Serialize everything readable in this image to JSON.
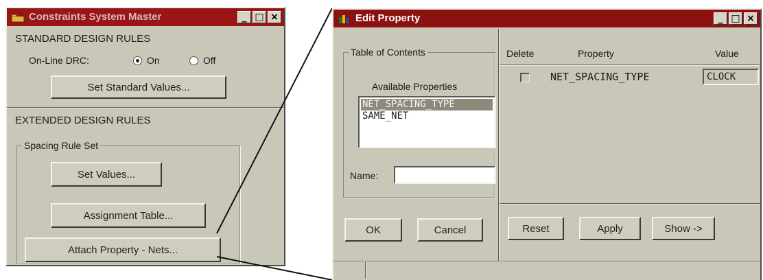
{
  "left_window": {
    "title": "Constraints System Master",
    "standard_section": "STANDARD DESIGN RULES",
    "online_drc_label": "On-Line DRC:",
    "radio_on_label": "On",
    "radio_off_label": "Off",
    "radio_selected": "On",
    "set_standard_values_button": "Set Standard Values...",
    "extended_section": "EXTENDED DESIGN RULES",
    "spacing_group_label": "Spacing Rule Set",
    "set_values_button": "Set Values...",
    "assignment_table_button": "Assignment Table...",
    "attach_property_button": "Attach Property - Nets..."
  },
  "right_window": {
    "title": "Edit Property",
    "toc_group_label": "Table of Contents",
    "available_properties_label": "Available Properties",
    "available_properties": [
      "NET_SPACING_TYPE",
      "SAME_NET"
    ],
    "selected_property": "NET_SPACING_TYPE",
    "name_label": "Name:",
    "name_value": "",
    "table_headers": {
      "delete": "Delete",
      "property": "Property",
      "value": "Value"
    },
    "rows": [
      {
        "property": "NET_SPACING_TYPE",
        "value": "CLOCK",
        "delete_checked": false
      }
    ],
    "ok_button": "OK",
    "cancel_button": "Cancel",
    "reset_button": "Reset",
    "apply_button": "Apply",
    "show_button": "Show ->"
  },
  "window_controls": {
    "minimize": "_",
    "maximize": "□",
    "close": "×"
  },
  "icons": {
    "left_app_icon": "folder-icon",
    "right_app_icon": "property-icon"
  },
  "colors": {
    "titlebar": "#8c1111",
    "window_bg": "#c9c7b7",
    "selection": "#8c8a7a"
  }
}
